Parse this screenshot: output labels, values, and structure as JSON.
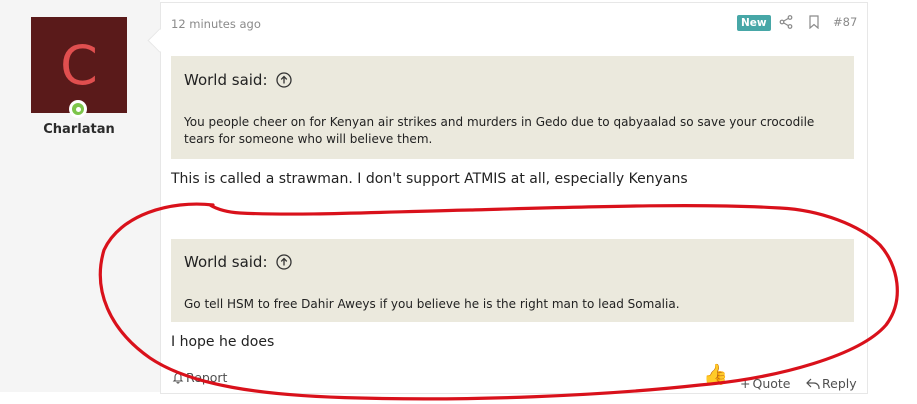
{
  "user": {
    "avatar_letter": "C",
    "username": "Charlatan"
  },
  "post": {
    "timestamp": "12 minutes ago",
    "badge": "New",
    "post_number": "#87",
    "quotes": [
      {
        "author": "World said:",
        "text": "You people cheer on for Kenyan air strikes and murders in Gedo due to qabyaalad so save your crocodile tears for someone who will believe them."
      },
      {
        "author": "World said:",
        "text": "Go tell HSM to free Dahir Aweys if you believe he is the right man to lead Somalia."
      }
    ],
    "replies": [
      "This is called a strawman. I don't support ATMIS at all, especially Kenyans",
      "I hope he does"
    ]
  },
  "footer": {
    "report": "Report",
    "quote": "Quote",
    "reply": "Reply"
  },
  "icons": {
    "share": "share-icon",
    "bookmark": "bookmark-icon",
    "expand_quote": "arrow-up-circle-icon",
    "reaction": "thumbs-up-icon"
  },
  "colors": {
    "badge_bg": "#47a7a7",
    "quote_bg": "#ebe9dd",
    "avatar_bg": "#5a1a1a",
    "avatar_letter": "#e04f4f",
    "annotation": "#d9111b"
  }
}
